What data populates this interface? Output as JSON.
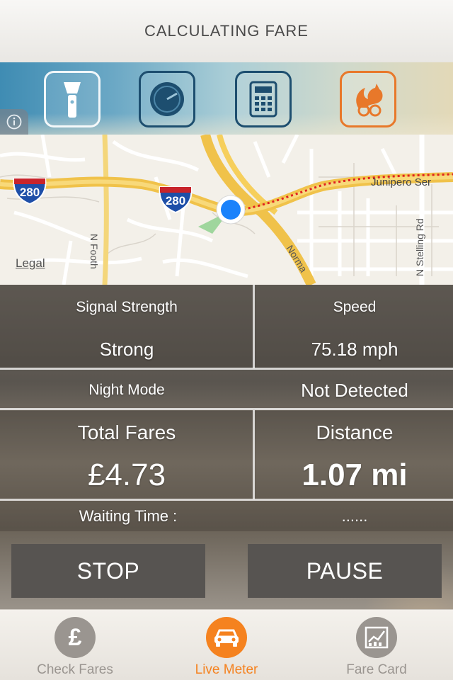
{
  "header": {
    "title": "CALCULATING FARE"
  },
  "tools": [
    {
      "name": "flashlight",
      "icon": "flashlight-icon"
    },
    {
      "name": "compass",
      "icon": "compass-icon"
    },
    {
      "name": "calculator",
      "icon": "calculator-icon"
    },
    {
      "name": "uc-browser",
      "icon": "squirrel-icon"
    }
  ],
  "map": {
    "legal": "Legal",
    "shields": [
      "280",
      "280"
    ],
    "street_labels": [
      "Junipero Ser",
      "N Stelling Rd",
      "N Footh",
      "Norma"
    ]
  },
  "stats": {
    "signal_label": "Signal Strength",
    "signal_value": "Strong",
    "speed_label": "Speed",
    "speed_value": "75.18 mph",
    "night_label": "Night Mode",
    "night_value": "Not Detected",
    "fares_label": "Total Fares",
    "fares_value": "£4.73",
    "distance_label": "Distance",
    "distance_value": "1.07 mi",
    "waiting_label": "Waiting Time :",
    "waiting_value": "......"
  },
  "buttons": {
    "stop": "STOP",
    "pause": "PAUSE"
  },
  "tabbar": {
    "tabs": [
      {
        "label": "Check Fares",
        "icon": "pound-icon",
        "active": false
      },
      {
        "label": "Live Meter",
        "icon": "car-icon",
        "active": true
      },
      {
        "label": "Fare Card",
        "icon": "chart-icon",
        "active": false
      }
    ]
  },
  "colors": {
    "accent": "#f5821f",
    "inactive": "#9a9590",
    "location_dot": "#1a82fb"
  }
}
